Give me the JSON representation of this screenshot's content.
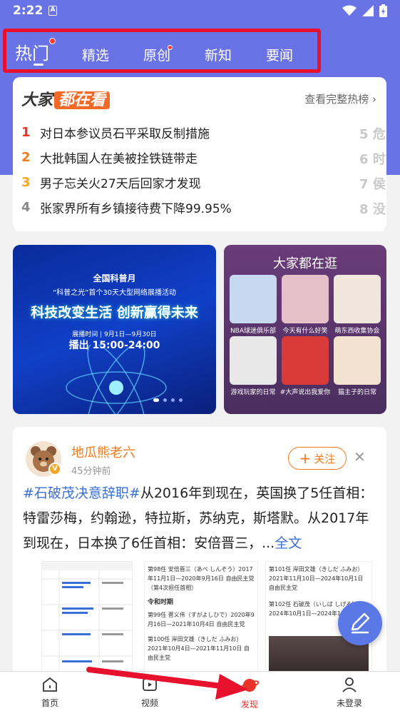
{
  "status": {
    "time": "2:22",
    "notif": "A"
  },
  "tabs": [
    {
      "label": "热门"
    },
    {
      "label": "精选"
    },
    {
      "label": "原创"
    },
    {
      "label": "新知"
    },
    {
      "label": "要闻"
    }
  ],
  "hot": {
    "logo_a": "大家",
    "logo_b": "都在看",
    "more": "查看完整热榜 ›",
    "items": [
      {
        "rank": "1",
        "title": "对日本参议员石平采取反制措施",
        "rank_color": "#e8322a"
      },
      {
        "rank": "2",
        "title": "大批韩国人在美被拴铁链带走",
        "rank_color": "#f27a1a"
      },
      {
        "rank": "3",
        "title": "男子忘关火27天后回家才发现",
        "rank_color": "#f5a623"
      },
      {
        "rank": "4",
        "title": "张家界所有乡镇接待费下降99.95%",
        "rank_color": "#888888"
      }
    ],
    "right_ranks": [
      "5",
      "6",
      "7",
      "8"
    ],
    "right_chars": [
      "危",
      "时",
      "侯",
      "没"
    ]
  },
  "banner": {
    "line1": "全国科普月",
    "line2": "“科普之光”首个30天大型网络展播活动",
    "line3": "科技改变生活 创新赢得未来",
    "line4": "展播时间 | 9月1日—9月30日",
    "line5": "播出 15:00-24:00"
  },
  "stroll": {
    "title": "大家都在逛",
    "items": [
      {
        "caption": "NBA球迷俱乐部"
      },
      {
        "caption": "今天有什么好笑"
      },
      {
        "caption": "萌东西收集协会"
      },
      {
        "caption": "游戏玩家的日常"
      },
      {
        "caption": "#大声说出我爱你"
      },
      {
        "caption": "猫主子的日常"
      }
    ]
  },
  "post": {
    "author": "地瓜熊老六",
    "time": "45分钟前",
    "follow": "关注",
    "tag": "#石破茂决意辞职#",
    "text": "从2016年到现在，英国换了5任首相：特雷莎梅，约翰逊，特拉斯，苏纳克，斯塔默。从2017年到现在，日本换了6任首相：安倍晋三，...",
    "more": "全文",
    "img2": {
      "h1": "第98任 安倍晋三（あべ しんぞう）2017年11月1日—2020年9月16日 自由民主党（第4次担任首相）",
      "h2": "令和时期",
      "h3": "第99任 菅义伟（すがよしひで）2020年9月16日—2021年10月4日 自由民主党",
      "h4": "第100任 岸田文雄（きしだ ふみお）2021年10月4日—2021年11月10日 自由民主党"
    },
    "img3": {
      "h1": "第101任 岸田文雄（きしだ ふみお）2021年11月10日—2024年10月1日 自由民主党",
      "h2": "第102任 石破茂（いしば しげる）2024年10月1日—2024年11月11日"
    }
  },
  "nav": [
    {
      "label": "首页"
    },
    {
      "label": "视频"
    },
    {
      "label": "发现"
    },
    {
      "label": "未登录"
    }
  ]
}
